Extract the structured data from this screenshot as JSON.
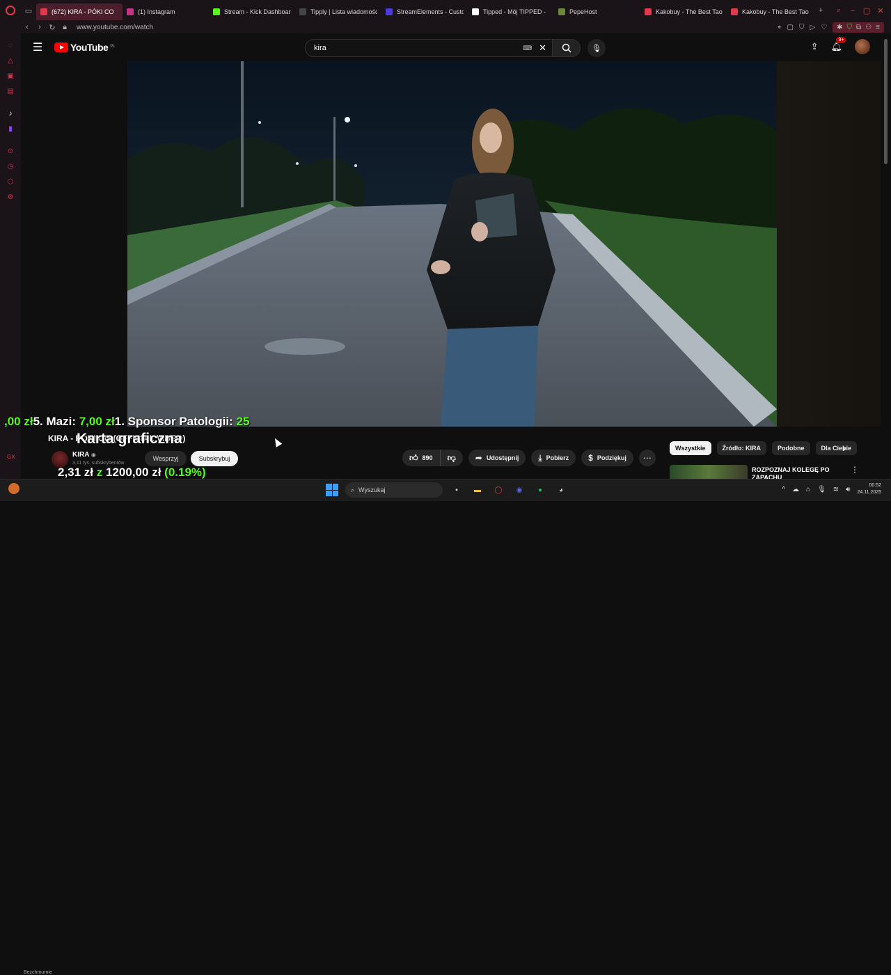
{
  "browser": {
    "tabs": [
      {
        "title": "(672) KIRA - PÓKI CO",
        "active": true,
        "fav_color": "#e33a4b"
      },
      {
        "title": "(1) Instagram",
        "active": false,
        "fav_color": "#c13584"
      },
      {
        "title": "Stream - Kick Dashboard",
        "active": false,
        "fav_color": "#53fc18"
      },
      {
        "title": "Tipply | Lista wiadomości",
        "active": false,
        "fav_color": "#444444"
      },
      {
        "title": "StreamElements - Custom",
        "active": false,
        "fav_color": "#4b3be0"
      },
      {
        "title": "Tipped - Mój TIPPED -",
        "active": false,
        "fav_color": "#ffffff"
      },
      {
        "title": "PepeHost",
        "active": false,
        "fav_color": "#6a8a3a"
      },
      {
        "title": "Kakobuy - The Best Taobao",
        "active": false,
        "fav_color": "#e33a4b"
      },
      {
        "title": "Kakobuy - The Best Taobao",
        "active": false,
        "fav_color": "#e33a4b"
      }
    ],
    "url": "www.youtube.com/watch"
  },
  "youtube": {
    "logo_text": "YouTube",
    "region": "PL",
    "search_value": "kira",
    "notif_count": "9+"
  },
  "overlay": {
    "ticker_parts": [
      {
        "text": ",00 zł",
        "green": true
      },
      {
        "text": "5. Mazi: ",
        "green": false
      },
      {
        "text": "7,00 zł",
        "green": true
      },
      {
        "text": "1. Sponsor Patologii: ",
        "green": false
      },
      {
        "text": "25",
        "green": true
      }
    ],
    "card_text": "Karta graficzna",
    "goal_current": "2,31 zł",
    "goal_of": "z",
    "goal_target": "1200,00 zł",
    "goal_pct": "(0.19%)",
    "goal_fraction": 0.0019,
    "gx": "GX",
    "status": "Bezchmurnie"
  },
  "video": {
    "title": "KIRA - PÓKI CO (OFFICIAL VIDEO)",
    "channel": "KIRA",
    "subs": "3,11 tys. subskrybentów",
    "support_label": "Wesprzyj",
    "subscribe_label": "Subskrybuj",
    "likes": "890",
    "share_label": "Udostępnij",
    "download_label": "Pobierz",
    "thanks_label": "Podziękuj"
  },
  "related": {
    "chips": [
      "Wszystkie",
      "Źródło: KIRA",
      "Podobne",
      "Dla Ciebie"
    ],
    "first_title": "ROZPOZNAJ KOLEGĘ PO ZAPACHU"
  },
  "taskbar": {
    "search_placeholder": "Wyszukaj",
    "time": "00:52",
    "date": "24.11.2025"
  }
}
